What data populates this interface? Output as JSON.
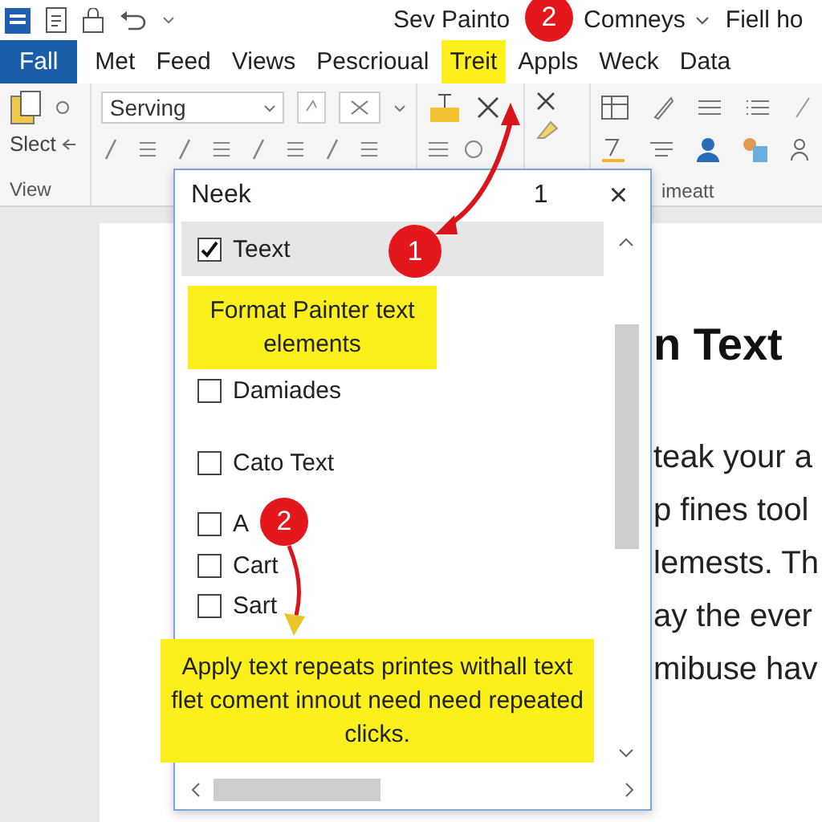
{
  "title_bar": {
    "title": "Sev Painto",
    "account": "Comneys",
    "right_text": "Fiell ho"
  },
  "tabs": [
    {
      "label": "Fall",
      "selected": true,
      "highlighted": false
    },
    {
      "label": "Met",
      "selected": false,
      "highlighted": false
    },
    {
      "label": "Feed",
      "selected": false,
      "highlighted": false
    },
    {
      "label": "Views",
      "selected": false,
      "highlighted": false
    },
    {
      "label": "Pescrioual",
      "selected": false,
      "highlighted": false
    },
    {
      "label": "Treit",
      "selected": false,
      "highlighted": true
    },
    {
      "label": "Appls",
      "selected": false,
      "highlighted": false
    },
    {
      "label": "Weck",
      "selected": false,
      "highlighted": false
    },
    {
      "label": "Data",
      "selected": false,
      "highlighted": false
    }
  ],
  "ribbon": {
    "select_label": "Slect",
    "font_box": {
      "value": "Serving"
    },
    "group_labels": [
      "View",
      "imeatt"
    ]
  },
  "document": {
    "heading": "n Text",
    "lines": [
      "teak your a",
      "p fines tool",
      "lemests. Th",
      "ay the ever",
      "mibuse hav"
    ]
  },
  "panel": {
    "title": "Neek",
    "count": "1",
    "close": "×",
    "items": [
      {
        "label": "Teext",
        "checked": true,
        "selected": true
      },
      {
        "label": "Damiades",
        "checked": false,
        "selected": false
      },
      {
        "label": "Cato Text",
        "checked": false,
        "selected": false
      },
      {
        "label": "A",
        "checked": false,
        "selected": false
      },
      {
        "label": "Cart",
        "checked": false,
        "selected": false
      },
      {
        "label": "Sart",
        "checked": false,
        "selected": false
      }
    ]
  },
  "callouts": [
    {
      "text": "Format Painter text elements"
    },
    {
      "text": "Apply text repeats printes withall text flet coment innout need need repeated clicks."
    }
  ],
  "markers": [
    {
      "label": "2"
    },
    {
      "label": "1"
    },
    {
      "label": "2"
    }
  ]
}
